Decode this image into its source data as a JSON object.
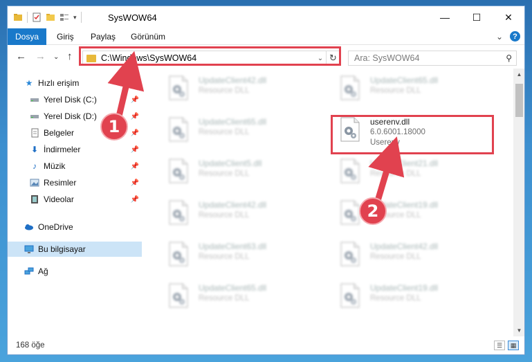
{
  "window": {
    "title": "SysWOW64",
    "controls": {
      "minimize": "—",
      "maximize": "☐",
      "close": "✕"
    }
  },
  "ribbon": {
    "tabs": [
      "Dosya",
      "Giriş",
      "Paylaş",
      "Görünüm"
    ],
    "expand_glyph": "⌄",
    "help_glyph": "?"
  },
  "nav": {
    "back_glyph": "←",
    "forward_glyph": "→",
    "recent_glyph": "⌄",
    "up_glyph": "↑"
  },
  "address": {
    "path": "C:\\Windows\\SysWOW64",
    "dropdown_glyph": "⌄",
    "refresh_glyph": "↻"
  },
  "search": {
    "placeholder": "Ara: SysWOW64",
    "icon_glyph": "⚲"
  },
  "sidebar": {
    "items": [
      {
        "label": "Hızlı erişim",
        "icon": "star-icon",
        "pinned": false
      },
      {
        "label": "Yerel Disk (C:)",
        "icon": "drive-icon",
        "pinned": true
      },
      {
        "label": "Yerel Disk (D:)",
        "icon": "drive-icon",
        "pinned": true
      },
      {
        "label": "Belgeler",
        "icon": "documents-icon",
        "pinned": true
      },
      {
        "label": "İndirmeler",
        "icon": "download-icon",
        "pinned": true
      },
      {
        "label": "Müzik",
        "icon": "music-icon",
        "pinned": true
      },
      {
        "label": "Resimler",
        "icon": "pictures-icon",
        "pinned": true
      },
      {
        "label": "Videolar",
        "icon": "videos-icon",
        "pinned": true
      },
      {
        "label": "OneDrive",
        "icon": "cloud-icon",
        "pinned": false
      },
      {
        "label": "Bu bilgisayar",
        "icon": "computer-icon",
        "pinned": false,
        "selected": true
      },
      {
        "label": "Ağ",
        "icon": "network-icon",
        "pinned": false
      }
    ],
    "pin_glyph": "📌"
  },
  "files": {
    "left": [
      {
        "name": "UpdateClient42.dll",
        "desc": "Resource DLL"
      },
      {
        "name": "UpdateClient65.dll",
        "desc": "Resource DLL"
      },
      {
        "name": "UpdateClient5.dll",
        "desc": "Resource DLL"
      },
      {
        "name": "UpdateClient42.dll",
        "desc": "Resource DLL"
      },
      {
        "name": "UpdateClient63.dll",
        "desc": "Resource DLL"
      },
      {
        "name": "UpdateClient65.dll",
        "desc": "Resource DLL"
      }
    ],
    "right": [
      {
        "name": "UpdateClient65.dll",
        "desc": "Resource DLL"
      },
      {
        "name": "userenv.dll",
        "desc": "6.0.6001.18000",
        "desc2": "Userenv",
        "highlight": true
      },
      {
        "name": "UpdateClient21.dll",
        "desc": "Resource DLL"
      },
      {
        "name": "UpdateClient19.dll",
        "desc": "Resource DLL"
      },
      {
        "name": "UpdateClient42.dll",
        "desc": "Resource DLL"
      },
      {
        "name": "UpdateClient19.dll",
        "desc": "Resource DLL"
      }
    ]
  },
  "scrollbar": {
    "up_glyph": "▲",
    "down_glyph": "▼"
  },
  "status": {
    "count": "168 öğe"
  },
  "view_buttons": {
    "details_glyph": "☰",
    "tiles_glyph": "▦"
  },
  "annotations": {
    "badge1": "1",
    "badge2": "2",
    "color": "#e1424f"
  }
}
